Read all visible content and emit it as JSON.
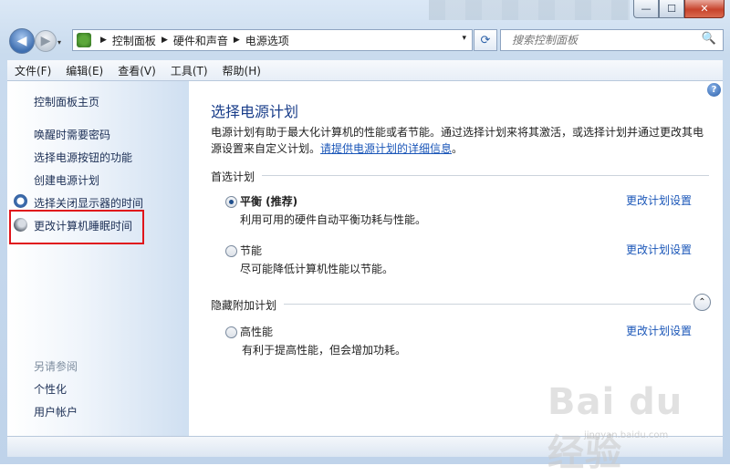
{
  "window": {
    "caption_buttons": {
      "min": "—",
      "max": "☐",
      "close": "✕"
    }
  },
  "nav": {
    "back_icon": "◀",
    "forward_icon": "▶",
    "dropdown_icon": "▾",
    "breadcrumb": [
      "控制面板",
      "硬件和声音",
      "电源选项"
    ],
    "refresh_icon": "⟳",
    "search_placeholder": "搜索控制面板",
    "search_icon": "🔍"
  },
  "menu": [
    "文件(F)",
    "编辑(E)",
    "查看(V)",
    "工具(T)",
    "帮助(H)"
  ],
  "sidebar": {
    "home": "控制面板主页",
    "links": [
      "唤醒时需要密码",
      "选择电源按钮的功能",
      "创建电源计划",
      "选择关闭显示器的时间",
      "更改计算机睡眠时间"
    ],
    "see_also_title": "另请参阅",
    "see_also": [
      "个性化",
      "用户帐户"
    ]
  },
  "main": {
    "help_icon": "?",
    "title": "选择电源计划",
    "desc": "电源计划有助于最大化计算机的性能或者节能。通过选择计划来将其激活，或选择计划并通过更改其电源设置来自定义计划。",
    "desc_link": "请提供电源计划的详细信息",
    "desc_end": "。",
    "preferred_title": "首选计划",
    "hidden_title": "隐藏附加计划",
    "collapse_icon": "⌃",
    "plans": [
      {
        "name": "平衡 (推荐)",
        "desc": "利用可用的硬件自动平衡功耗与性能。",
        "change": "更改计划设置",
        "selected": true
      },
      {
        "name": "节能",
        "desc": "尽可能降低计算机性能以节能。",
        "change": "更改计划设置",
        "selected": false
      },
      {
        "name": "高性能",
        "desc": "有利于提高性能，但会增加功耗。",
        "change": "更改计划设置",
        "selected": false
      }
    ]
  },
  "watermark": {
    "logo": "Bai du 经验",
    "url": "jingyan.baidu.com"
  }
}
